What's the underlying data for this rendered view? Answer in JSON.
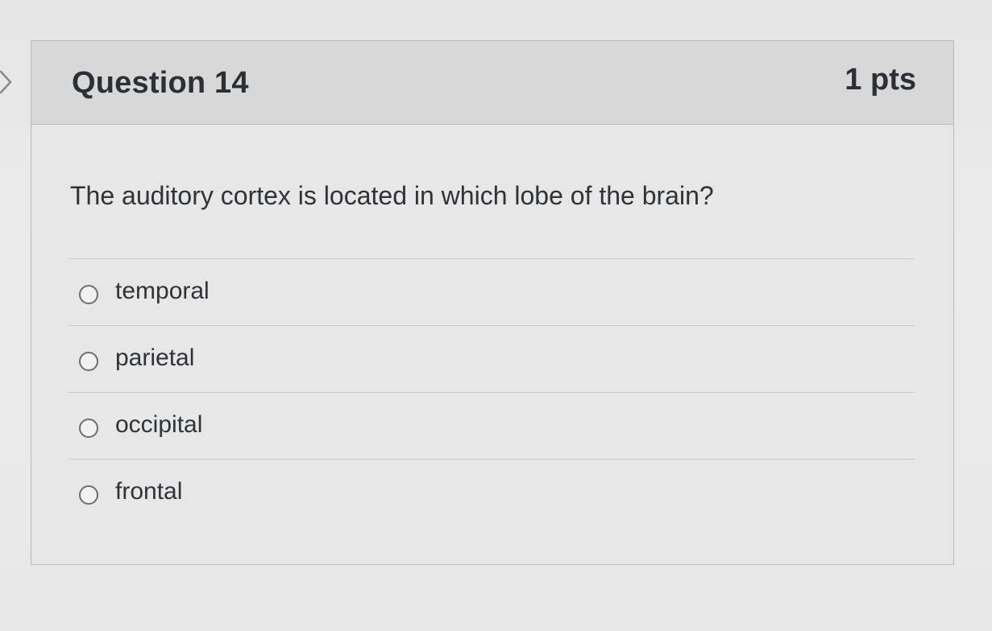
{
  "question": {
    "title": "Question 14",
    "points": "1 pts",
    "text": "The auditory cortex is located in which lobe of the brain?",
    "answers": [
      {
        "label": "temporal"
      },
      {
        "label": "parietal"
      },
      {
        "label": "occipital"
      },
      {
        "label": "frontal"
      }
    ]
  },
  "icons": {
    "left_marker": "chevron-right-icon",
    "answer_option": "radio-empty-icon"
  },
  "colors": {
    "header_bg": "#d8d8d8",
    "card_bg": "#e7e7e7",
    "text": "#2f3237"
  }
}
